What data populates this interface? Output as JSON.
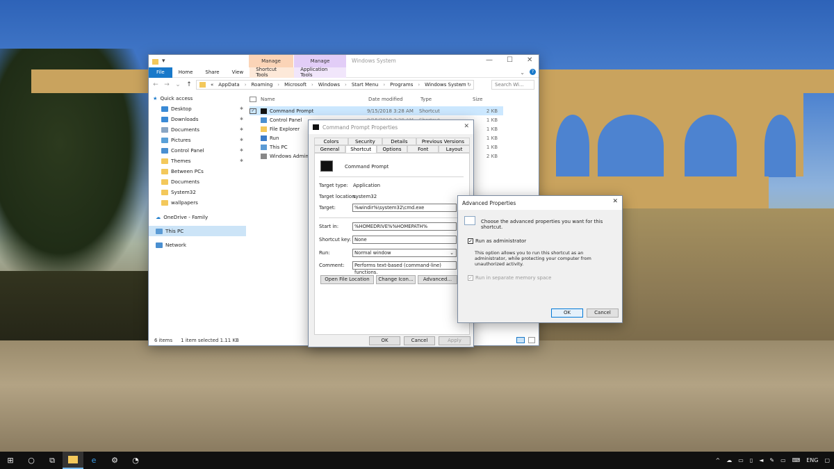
{
  "explorer": {
    "manage1": "Manage",
    "manage2": "Manage",
    "title": "Windows System",
    "tabs": [
      "File",
      "Home",
      "Share",
      "View",
      "Shortcut Tools",
      "Application Tools"
    ],
    "breadcrumb": [
      "«",
      "AppData",
      "Roaming",
      "Microsoft",
      "Windows",
      "Start Menu",
      "Programs",
      "Windows System"
    ],
    "search_placeholder": "Search Wi...",
    "columns": {
      "name": "Name",
      "date": "Date modified",
      "type": "Type",
      "size": "Size"
    },
    "files": [
      {
        "name": "Command Prompt",
        "date": "9/15/2018 3:28 AM",
        "type": "Shortcut",
        "size": "2 KB"
      },
      {
        "name": "Control Panel",
        "date": "9/15/2018 3:28 AM",
        "type": "Shortcut",
        "size": "1 KB"
      },
      {
        "name": "File Explorer",
        "date": "",
        "type": "",
        "size": "1 KB"
      },
      {
        "name": "Run",
        "date": "",
        "type": "",
        "size": "1 KB"
      },
      {
        "name": "This PC",
        "date": "",
        "type": "",
        "size": "1 KB"
      },
      {
        "name": "Windows Admin",
        "date": "",
        "type": "",
        "size": "2 KB"
      }
    ],
    "nav": {
      "quick_access": "Quick access",
      "items": [
        "Desktop",
        "Downloads",
        "Documents",
        "Pictures",
        "Control Panel",
        "Themes",
        "Between PCs",
        "Documents",
        "System32",
        "wallpapers"
      ],
      "onedrive": "OneDrive - Family",
      "thispc": "This PC",
      "network": "Network"
    },
    "status": {
      "count": "6 items",
      "selected": "1 item selected  1.11 KB"
    }
  },
  "props": {
    "title": "Command Prompt Properties",
    "tabs_row1": [
      "Colors",
      "Security",
      "Details",
      "Previous Versions"
    ],
    "tabs_row2": [
      "General",
      "Shortcut",
      "Options",
      "Font",
      "Layout"
    ],
    "name": "Command Prompt",
    "target_type_label": "Target type:",
    "target_type": "Application",
    "target_location_label": "Target location:",
    "target_location": "system32",
    "target_label": "Target:",
    "target": "%windir%\\system32\\cmd.exe",
    "startin_label": "Start in:",
    "startin": "%HOMEDRIVE%%HOMEPATH%",
    "shortcutkey_label": "Shortcut key:",
    "shortcutkey": "None",
    "run_label": "Run:",
    "run": "Normal window",
    "comment_label": "Comment:",
    "comment": "Performs text-based (command-line) functions.",
    "btn_open": "Open File Location",
    "btn_icon": "Change Icon...",
    "btn_adv": "Advanced...",
    "ok": "OK",
    "cancel": "Cancel",
    "apply": "Apply"
  },
  "advanced": {
    "title": "Advanced Properties",
    "desc": "Choose the advanced properties you want for this shortcut.",
    "run_admin": "Run as administrator",
    "run_admin_desc": "This option allows you to run this shortcut as an administrator, while protecting your computer from unauthorized activity.",
    "separate_mem": "Run in separate memory space",
    "ok": "OK",
    "cancel": "Cancel"
  },
  "taskbar": {
    "lang": "ENG"
  }
}
